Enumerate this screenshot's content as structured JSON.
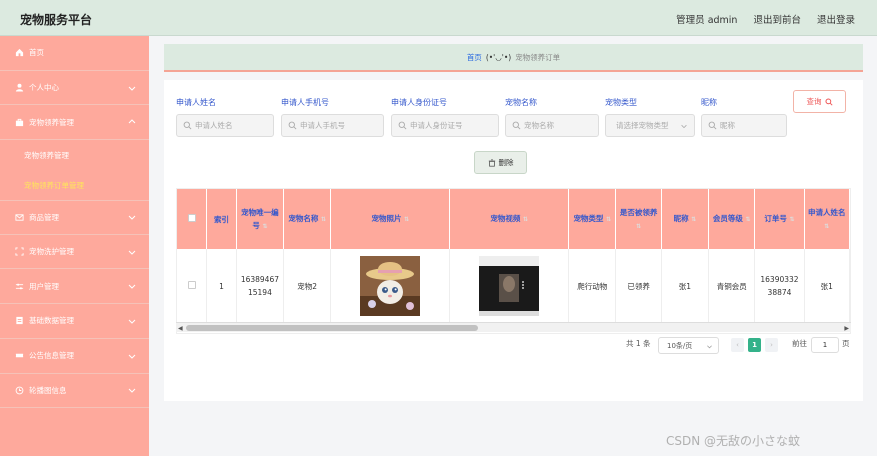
{
  "app": {
    "title": "宠物服务平台"
  },
  "topnav": {
    "admin": "管理员 admin",
    "front": "退出到前台",
    "logout": "退出登录"
  },
  "sidebar": {
    "items": [
      {
        "label": "首页",
        "icon": "home-icon"
      },
      {
        "label": "个人中心",
        "icon": "user-icon"
      },
      {
        "label": "宠物领养管理",
        "icon": "briefcase-icon"
      },
      {
        "label": "商品管理",
        "icon": "mail-icon"
      },
      {
        "label": "宠物洗护管理",
        "icon": "frame-icon"
      },
      {
        "label": "用户管理",
        "icon": "sliders-icon"
      },
      {
        "label": "基础数据管理",
        "icon": "document-icon"
      },
      {
        "label": "公告信息管理",
        "icon": "ticket-icon"
      },
      {
        "label": "轮播图信息",
        "icon": "clock-icon"
      }
    ],
    "sub_items": [
      {
        "label": "宠物领养管理"
      },
      {
        "label": "宠物领养订单管理"
      }
    ]
  },
  "breadcrumb": {
    "home": "首页",
    "emoji": "(•'◡'•)",
    "current": "宠物领养订单"
  },
  "filters": [
    {
      "label": "申请人姓名",
      "placeholder": "申请人姓名"
    },
    {
      "label": "申请人手机号",
      "placeholder": "申请人手机号"
    },
    {
      "label": "申请人身份证号",
      "placeholder": "申请人身份证号"
    },
    {
      "label": "宠物名称",
      "placeholder": "宠物名称"
    },
    {
      "label": "宠物类型",
      "placeholder": "请选择宠物类型"
    },
    {
      "label": "昵称",
      "placeholder": "昵称"
    }
  ],
  "buttons": {
    "query": "查询",
    "delete": "删除"
  },
  "table": {
    "headers": [
      "索引",
      "宠物唯一编号",
      "宠物名称",
      "宠物照片",
      "宠物视频",
      "宠物类型",
      "是否被领养",
      "昵称",
      "会员等级",
      "订单号",
      "申请人姓名"
    ],
    "rows": [
      {
        "index": "1",
        "pet_id": "1638946715194",
        "pet_name": "宠物2",
        "pet_type": "爬行动物",
        "adopted": "已领养",
        "nickname": "张1",
        "level": "青铜会员",
        "order_no": "1639033238874",
        "applicant": "张1"
      }
    ]
  },
  "pager": {
    "total": "共 1 条",
    "size": "10条/页",
    "current": "1",
    "goto": "前往",
    "page_input": "1",
    "page_unit": "页"
  },
  "watermark": "CSDN @无敌の小さな蚊",
  "colors": {
    "sidebar": "#fea99c",
    "header": "#dceae0",
    "accent": "#34b28a",
    "label": "#3558cc"
  }
}
